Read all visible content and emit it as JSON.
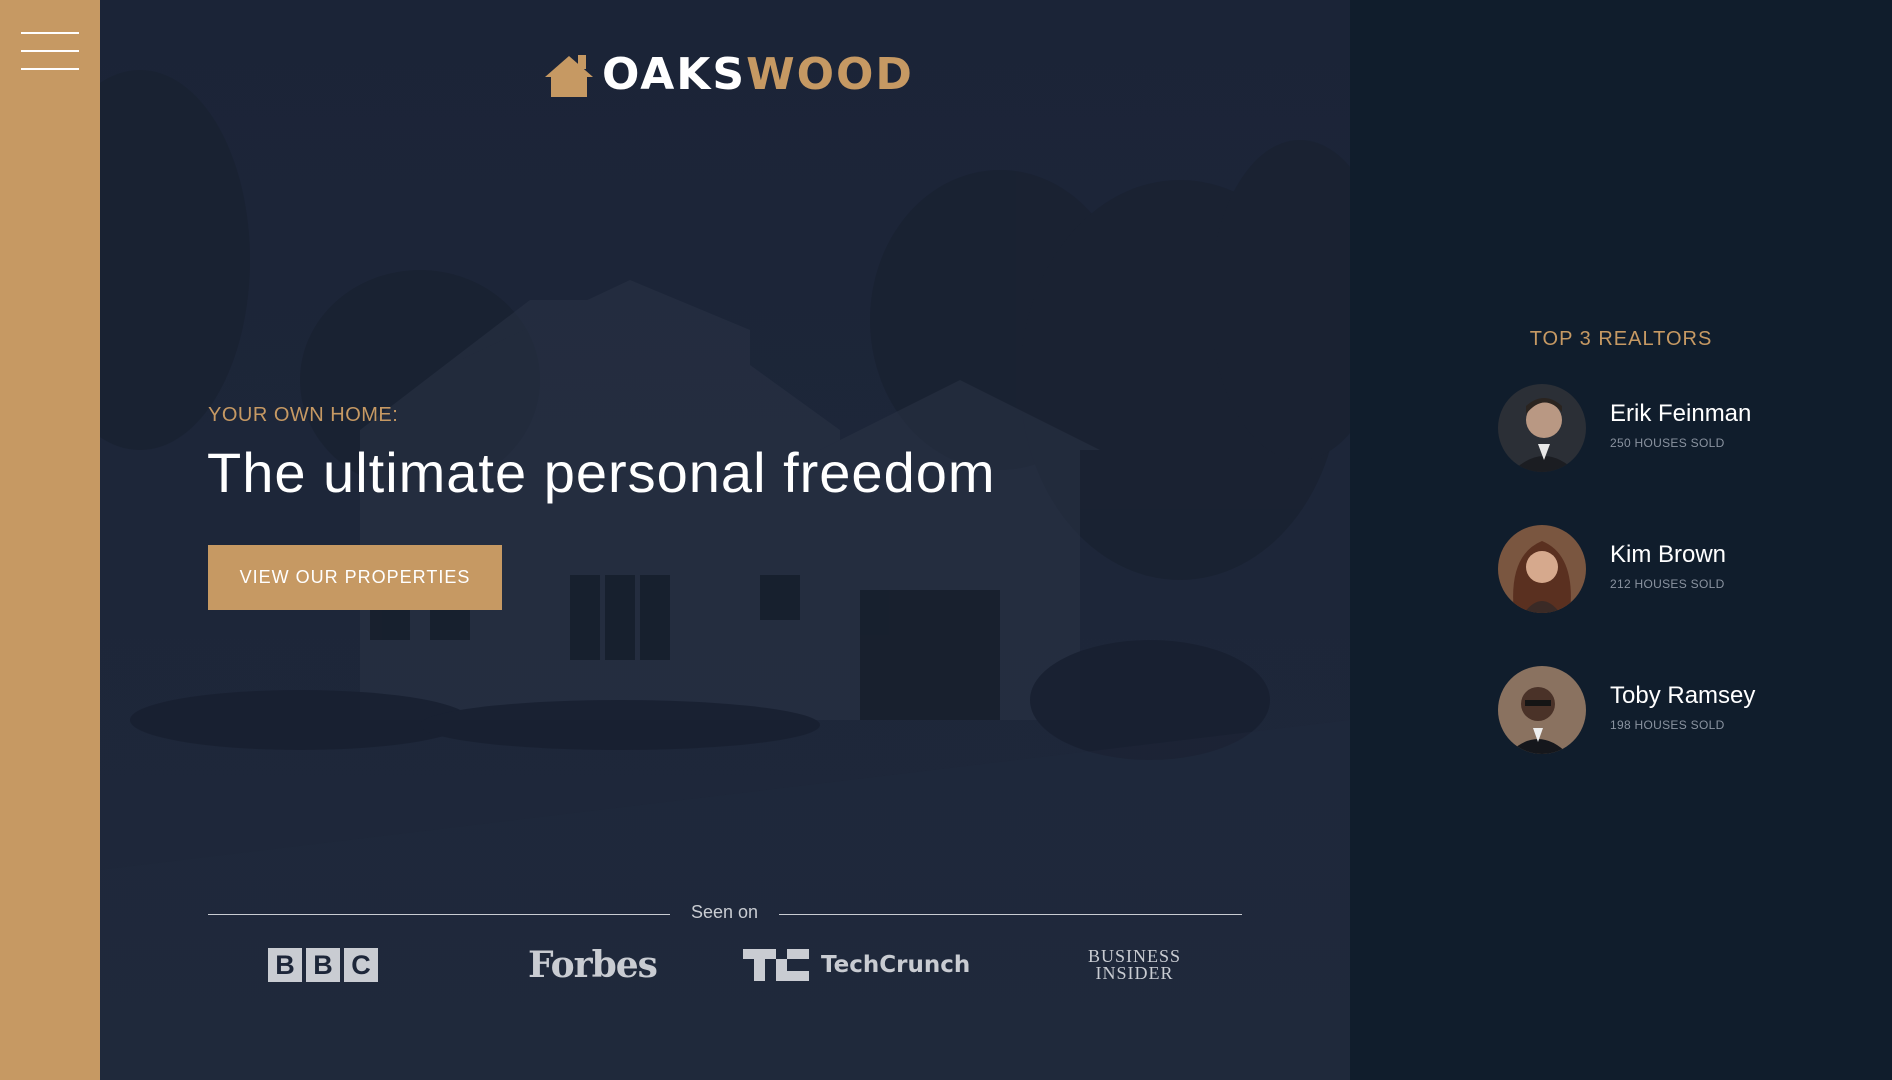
{
  "sidebar": {
    "menu_icon": "hamburger-menu-icon",
    "color": "#c69963"
  },
  "logo": {
    "icon": "house-icon",
    "text_a": "OAKS",
    "text_b": "WOOD"
  },
  "hero": {
    "eyebrow": "YOUR OWN HOME:",
    "headline": "The ultimate personal freedom",
    "cta_label": "VIEW OUR PROPERTIES"
  },
  "seen_on": {
    "label": "Seen on",
    "logos": {
      "bbc": [
        "B",
        "B",
        "C"
      ],
      "forbes": "Forbes",
      "techcrunch": "TechCrunch",
      "business_insider_1": "BUSINESS",
      "business_insider_2": "INSIDER"
    }
  },
  "realtors": {
    "title": "TOP 3 REALTORS",
    "items": [
      {
        "name": "Erik Feinman",
        "sold": "250 HOUSES SOLD"
      },
      {
        "name": "Kim Brown",
        "sold": "212 HOUSES SOLD"
      },
      {
        "name": "Toby Ramsey",
        "sold": "198 HOUSES SOLD"
      }
    ]
  },
  "colors": {
    "accent": "#c69963",
    "hero_bg": "#1d2639",
    "panel_bg": "#101d2c",
    "text_light": "#ffffff",
    "muted": "#8a93a0"
  }
}
